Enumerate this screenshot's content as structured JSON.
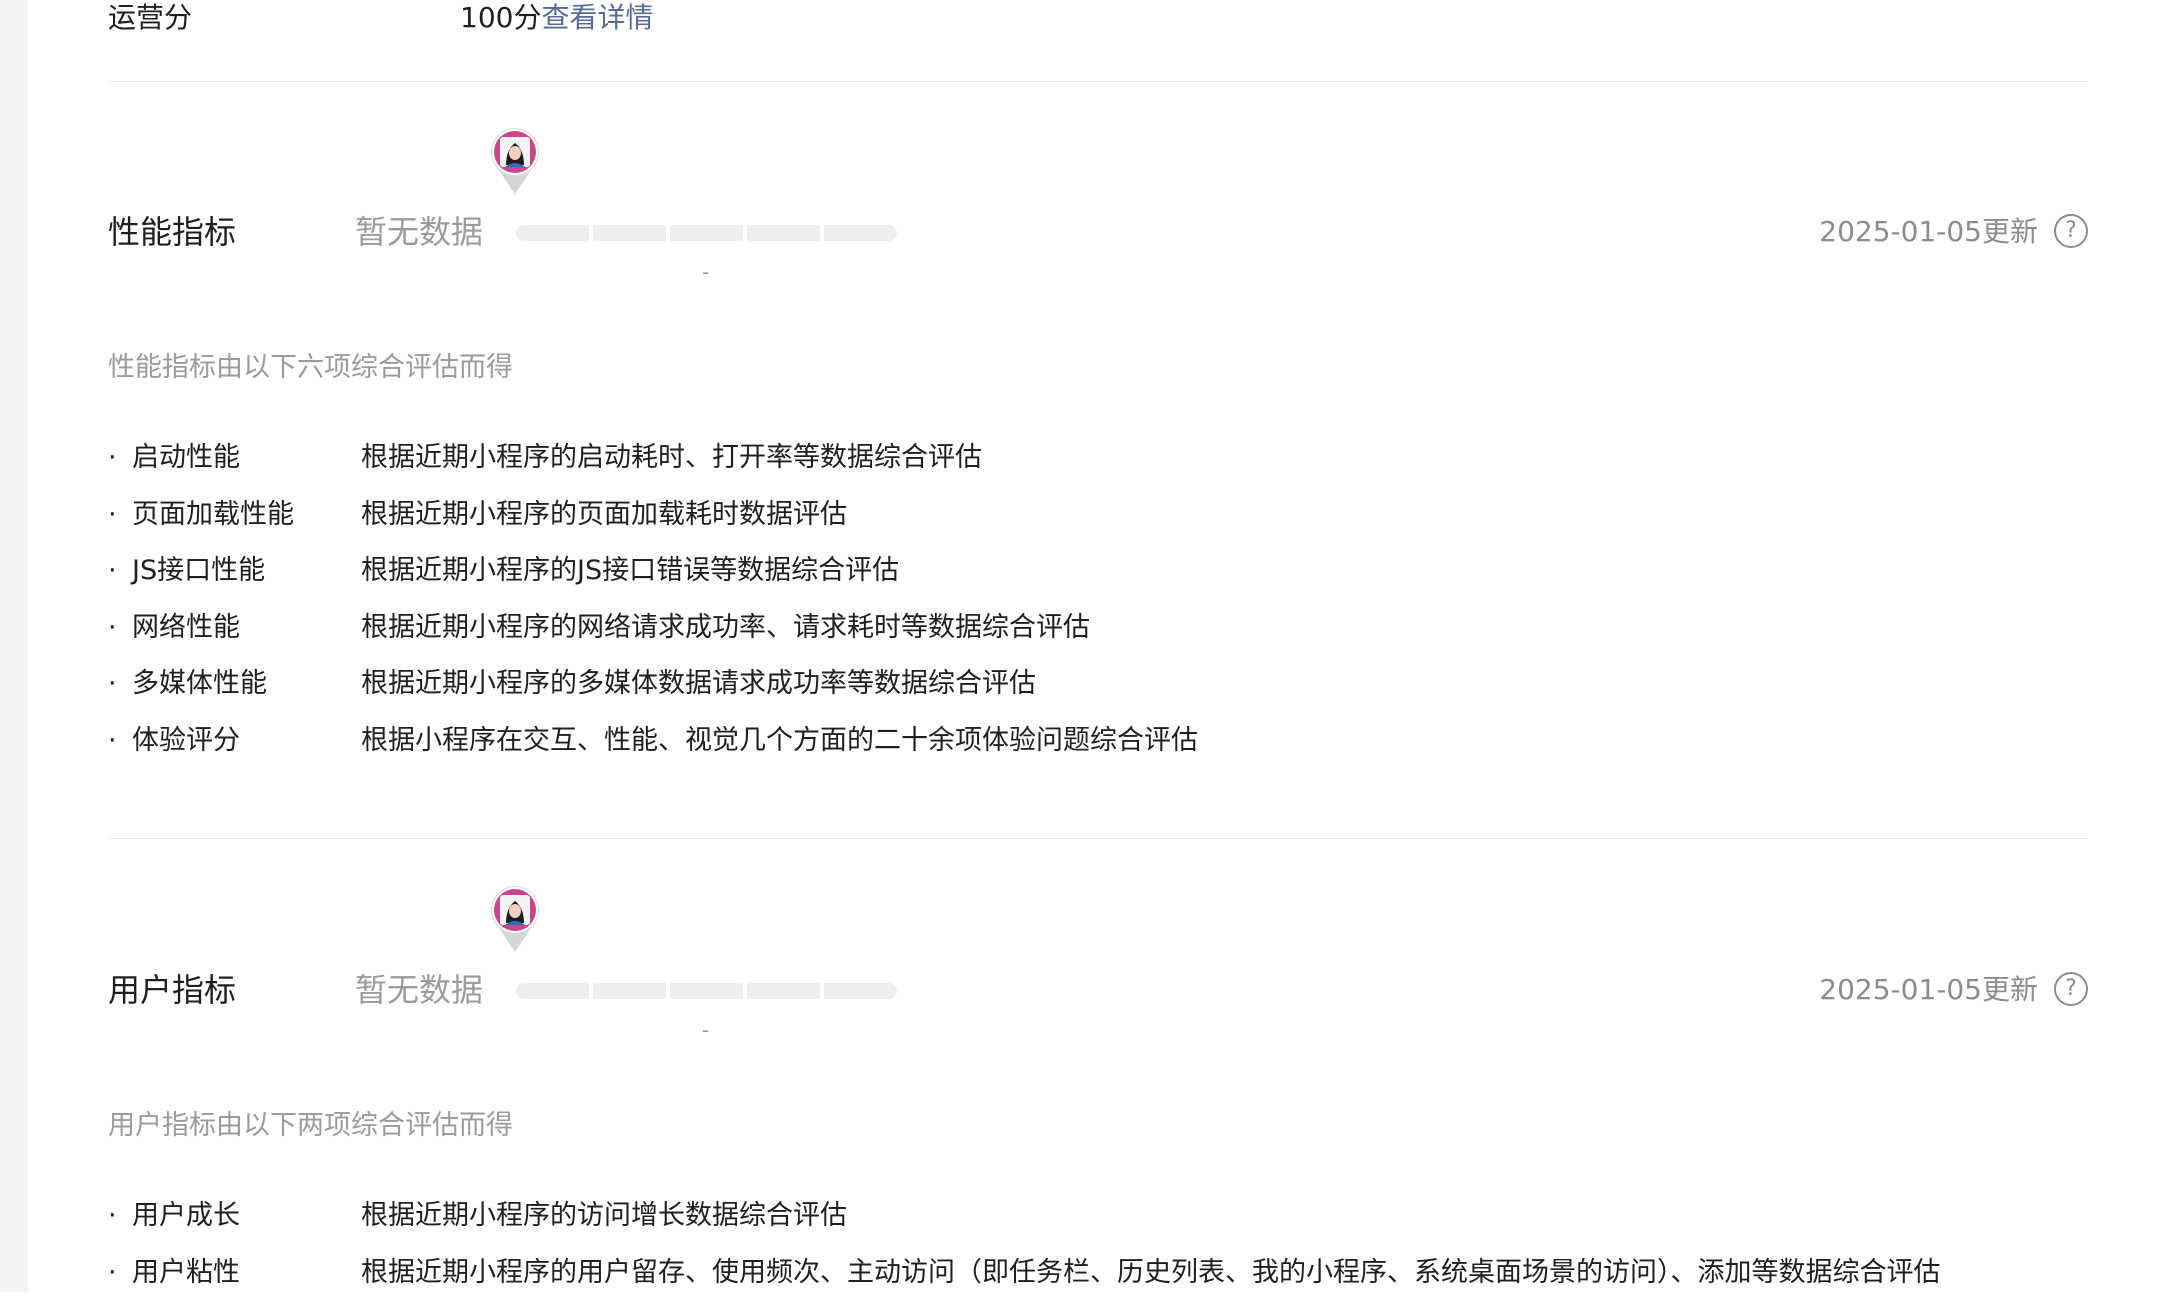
{
  "operation_score": {
    "label": "运营分",
    "value": "100分",
    "link": "查看详情"
  },
  "sections": [
    {
      "title": "性能指标",
      "status": "暂无数据",
      "score_dash": "-",
      "updated": "2025-01-05更新",
      "help_icon": "question-circle-icon",
      "avatar_icon": "avatar-location-pin-icon",
      "description": "性能指标由以下六项综合评估而得",
      "items": [
        {
          "bullet": "·",
          "name": "启动性能",
          "desc": "根据近期小程序的启动耗时、打开率等数据综合评估"
        },
        {
          "bullet": "·",
          "name": "页面加载性能",
          "desc": "根据近期小程序的页面加载耗时数据评估"
        },
        {
          "bullet": "·",
          "name": "JS接口性能",
          "desc": "根据近期小程序的JS接口错误等数据综合评估"
        },
        {
          "bullet": "·",
          "name": "网络性能",
          "desc": "根据近期小程序的网络请求成功率、请求耗时等数据综合评估"
        },
        {
          "bullet": "·",
          "name": "多媒体性能",
          "desc": "根据近期小程序的多媒体数据请求成功率等数据综合评估"
        },
        {
          "bullet": "·",
          "name": "体验评分",
          "desc": "根据小程序在交互、性能、视觉几个方面的二十余项体验问题综合评估"
        }
      ]
    },
    {
      "title": "用户指标",
      "status": "暂无数据",
      "score_dash": "-",
      "updated": "2025-01-05更新",
      "help_icon": "question-circle-icon",
      "avatar_icon": "avatar-location-pin-icon",
      "description": "用户指标由以下两项综合评估而得",
      "items": [
        {
          "bullet": "·",
          "name": "用户成长",
          "desc": "根据近期小程序的访问增长数据综合评估"
        },
        {
          "bullet": "·",
          "name": "用户粘性",
          "desc": "根据近期小程序的用户留存、使用频次、主动访问（即任务栏、历史列表、我的小程序、系统桌面场景的访问）、添加等数据综合评估"
        }
      ]
    }
  ],
  "help_glyph": "?"
}
